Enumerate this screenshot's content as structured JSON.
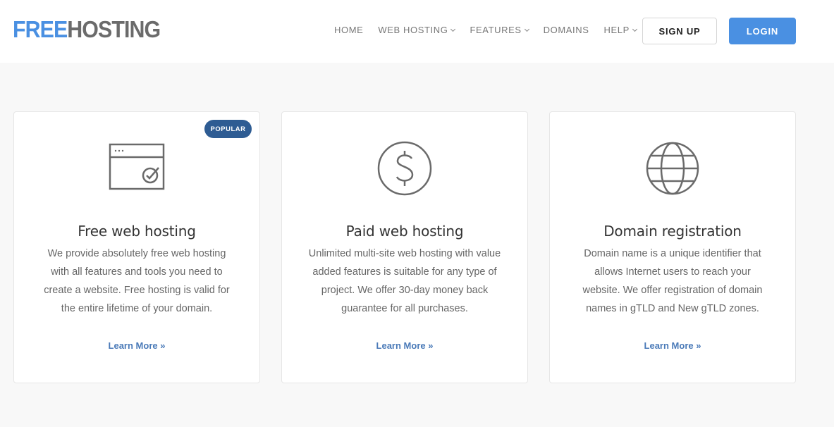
{
  "logo": {
    "free": "FREE",
    "hosting": "HOSTING"
  },
  "nav": {
    "items": [
      {
        "label": "HOME"
      },
      {
        "label": "WEB HOSTING"
      },
      {
        "label": "FEATURES"
      },
      {
        "label": "DOMAINS"
      },
      {
        "label": "HELP"
      }
    ],
    "signup_label": "SIGN UP",
    "login_label": "LOGIN"
  },
  "colors": {
    "accent": "#4a90e2",
    "badge": "#2e5c93",
    "link": "#4a7ab8",
    "icon": "#6a6a6a"
  },
  "cards": [
    {
      "icon": "browser-check-icon",
      "badge": "POPULAR",
      "title": "Free web hosting",
      "description": "We provide absolutely free web hosting with all features and tools you need to create a website. Free hosting is valid for the entire lifetime of your domain.",
      "link": "Learn More »"
    },
    {
      "icon": "dollar-circle-icon",
      "title": "Paid web hosting",
      "description": "Unlimited multi-site web hosting with value added features is suitable for any type of project. We offer 30-day money back guarantee for all purchases.",
      "link": "Learn More »"
    },
    {
      "icon": "globe-icon",
      "title": "Domain registration",
      "description": "Domain name is a unique identifier that allows Internet users to reach your website. We offer registration of domain names in gTLD and New gTLD zones.",
      "link": "Learn More »"
    }
  ]
}
